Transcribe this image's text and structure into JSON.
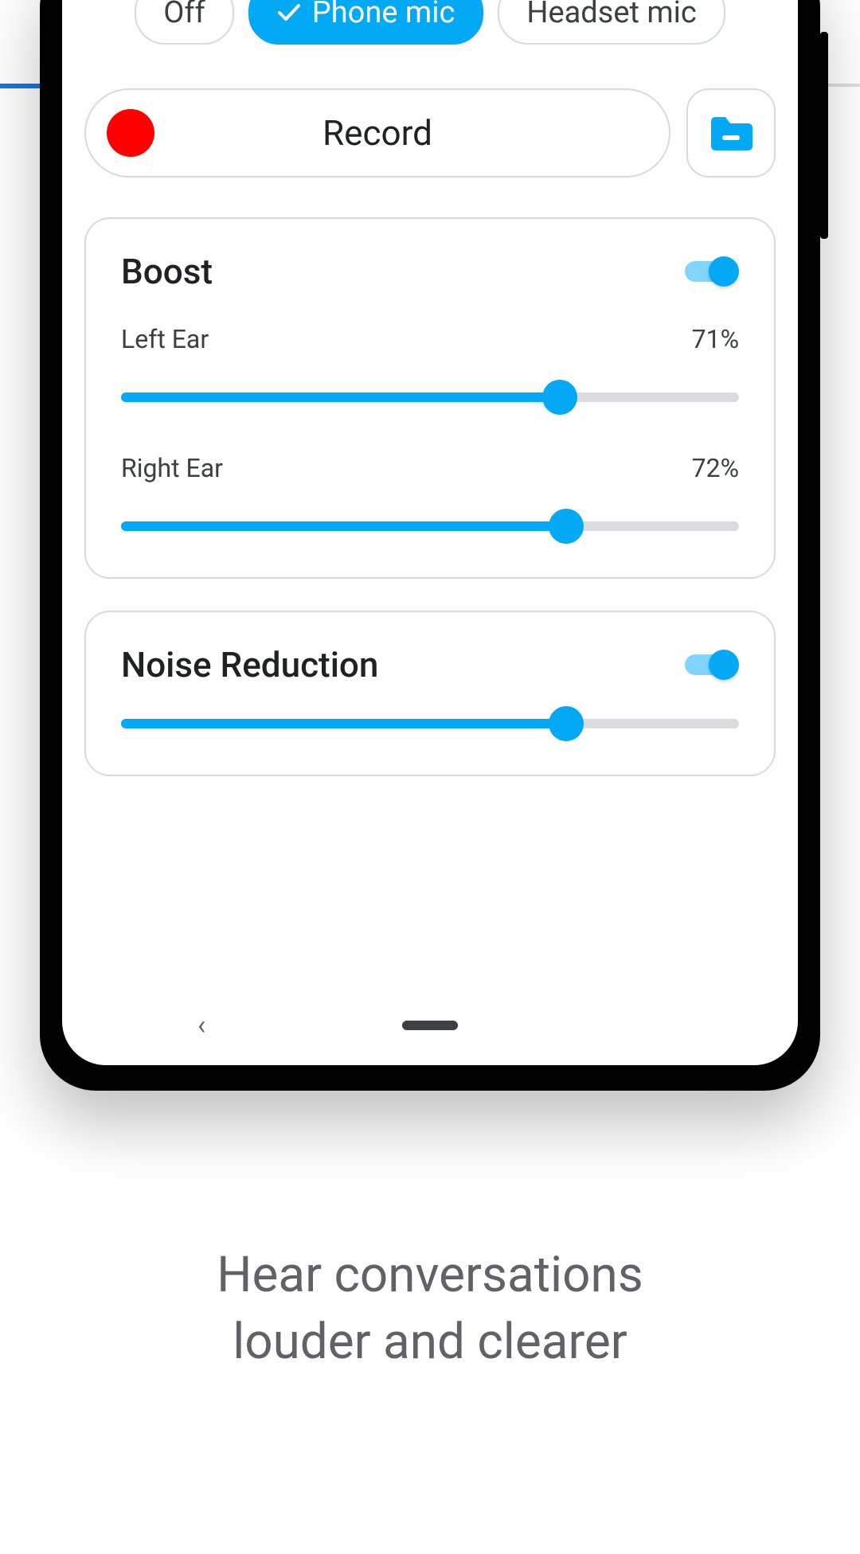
{
  "colors": {
    "accent": "#03a9f4",
    "border": "#d7dbe0",
    "text": "#202124",
    "muted": "#5f6368",
    "record": "#ff0000"
  },
  "mic_selector": {
    "options": [
      {
        "label": "Off",
        "active": false
      },
      {
        "label": "Phone mic",
        "active": true
      },
      {
        "label": "Headset mic",
        "active": false
      }
    ]
  },
  "record": {
    "label": "Record",
    "folder_icon": "folder-icon"
  },
  "boost": {
    "title": "Boost",
    "enabled": true,
    "sliders": [
      {
        "name": "Left Ear",
        "value_label": "71%",
        "value": 71
      },
      {
        "name": "Right Ear",
        "value_label": "72%",
        "value": 72
      }
    ]
  },
  "noise_reduction": {
    "title": "Noise Reduction",
    "enabled": true,
    "value": 72
  },
  "caption": "Hear conversations\nlouder and clearer"
}
